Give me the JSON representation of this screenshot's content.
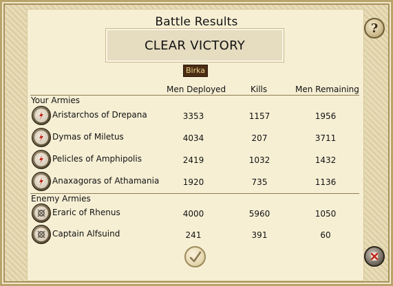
{
  "title": "Battle Results",
  "result": "CLEAR VICTORY",
  "location": "Birka",
  "columns": {
    "deployed": "Men Deployed",
    "kills": "Kills",
    "remaining": "Men Remaining"
  },
  "your_armies": {
    "heading": "Your Armies",
    "rows": [
      {
        "name": "Aristarchos of Drepana",
        "deployed": "3353",
        "kills": "1157",
        "remaining": "1956"
      },
      {
        "name": "Dymas of Miletus",
        "deployed": "4034",
        "kills": "207",
        "remaining": "3711"
      },
      {
        "name": "Pelicles of Amphipolis",
        "deployed": "2419",
        "kills": "1032",
        "remaining": "1432"
      },
      {
        "name": "Anaxagoras of Athamania",
        "deployed": "1920",
        "kills": "735",
        "remaining": "1136"
      }
    ]
  },
  "enemy_armies": {
    "heading": "Enemy Armies",
    "rows": [
      {
        "name": "Eraric of Rhenus",
        "deployed": "4000",
        "kills": "5960",
        "remaining": "1050"
      },
      {
        "name": "Captain Alfsuind",
        "deployed": "241",
        "kills": "391",
        "remaining": "60"
      }
    ]
  },
  "buttons": {
    "help": "?",
    "ok_icon": "checkmark-icon",
    "close_icon": "close-scroll-icon"
  },
  "colors": {
    "own_badge": "#c0261c",
    "enemy_badge": "#6a6256"
  }
}
